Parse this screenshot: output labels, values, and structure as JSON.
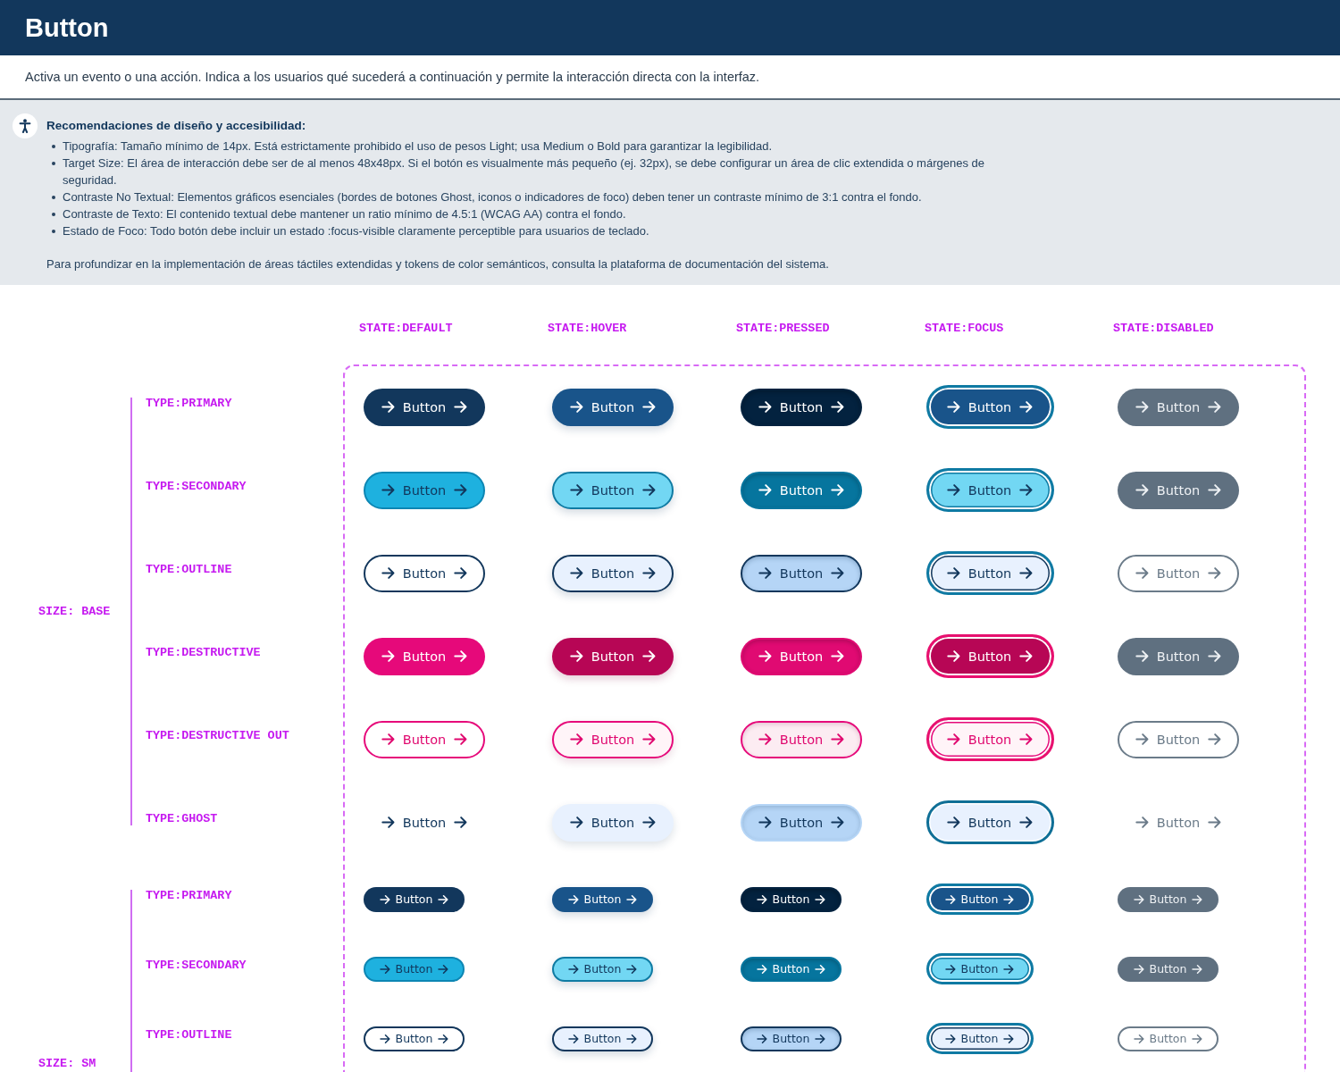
{
  "header": {
    "title": "Button"
  },
  "description": "Activa un evento o una acción. Indica a los usuarios qué sucederá a continuación y permite la interacción directa con la interfaz.",
  "guidelines": {
    "heading": "Recomendaciones de diseño y accesibilidad:",
    "items": [
      "Tipografía: Tamaño mínimo de 14px. Está estrictamente prohibido el uso de pesos Light; usa Medium o Bold para garantizar la legibilidad.",
      "Target Size: El área de interacción debe ser de al menos 48x48px. Si el botón es visualmente más pequeño (ej. 32px), se debe configurar un área de clic extendida o márgenes de seguridad.",
      "Contraste No Textual: Elementos gráficos esenciales (bordes de botones Ghost, iconos o indicadores de foco) deben tener un contraste mínimo de 3:1 contra el fondo.",
      "Contraste de Texto: El contenido textual debe mantener un ratio mínimo de 4.5:1 (WCAG AA) contra el fondo.",
      "Estado de Foco: Todo botón debe incluir un estado :focus-visible claramente perceptible para usuarios de teclado."
    ],
    "footer": "Para profundizar en la implementación de áreas táctiles extendidas y tokens de color semánticos, consulta la plataforma de documentación del sistema."
  },
  "matrix": {
    "states": [
      "STATE:DEFAULT",
      "STATE:HOVER",
      "STATE:PRESSED",
      "STATE:FOCUS",
      "STATE:DISABLED"
    ],
    "sizes": [
      {
        "label": "SIZE: BASE",
        "kind": "base",
        "types": [
          {
            "label": "TYPE:PRIMARY",
            "kind": "primary",
            "buttons": [
              {
                "label": "Button",
                "kind": "default"
              },
              {
                "label": "Button",
                "kind": "hover"
              },
              {
                "label": "Button",
                "kind": "pressed"
              },
              {
                "label": "Button",
                "kind": "focus"
              },
              {
                "label": "Button",
                "kind": "disabled"
              }
            ]
          },
          {
            "label": "TYPE:SECONDARY",
            "kind": "secondary",
            "buttons": [
              {
                "label": "Button",
                "kind": "default"
              },
              {
                "label": "Button",
                "kind": "hover"
              },
              {
                "label": "Button",
                "kind": "pressed"
              },
              {
                "label": "Button",
                "kind": "focus"
              },
              {
                "label": "Button",
                "kind": "disabled"
              }
            ]
          },
          {
            "label": "TYPE:OUTLINE",
            "kind": "outline",
            "buttons": [
              {
                "label": "Button",
                "kind": "default"
              },
              {
                "label": "Button",
                "kind": "hover"
              },
              {
                "label": "Button",
                "kind": "pressed"
              },
              {
                "label": "Button",
                "kind": "focus"
              },
              {
                "label": "Button",
                "kind": "disabled"
              }
            ]
          },
          {
            "label": "TYPE:DESTRUCTIVE",
            "kind": "destructive",
            "buttons": [
              {
                "label": "Button",
                "kind": "default"
              },
              {
                "label": "Button",
                "kind": "hover"
              },
              {
                "label": "Button",
                "kind": "pressed"
              },
              {
                "label": "Button",
                "kind": "focus"
              },
              {
                "label": "Button",
                "kind": "disabled"
              }
            ]
          },
          {
            "label": "TYPE:DESTRUCTIVE OUT",
            "kind": "destructiveout",
            "buttons": [
              {
                "label": "Button",
                "kind": "default"
              },
              {
                "label": "Button",
                "kind": "hover"
              },
              {
                "label": "Button",
                "kind": "pressed"
              },
              {
                "label": "Button",
                "kind": "focus"
              },
              {
                "label": "Button",
                "kind": "disabled"
              }
            ]
          },
          {
            "label": "TYPE:GHOST",
            "kind": "ghost",
            "buttons": [
              {
                "label": "Button",
                "kind": "default"
              },
              {
                "label": "Button",
                "kind": "hover"
              },
              {
                "label": "Button",
                "kind": "pressed"
              },
              {
                "label": "Button",
                "kind": "focus"
              },
              {
                "label": "Button",
                "kind": "disabled"
              }
            ]
          }
        ]
      },
      {
        "label": "SIZE: SM",
        "kind": "sm",
        "types": [
          {
            "label": "TYPE:PRIMARY",
            "kind": "primary",
            "buttons": [
              {
                "label": "Button",
                "kind": "default"
              },
              {
                "label": "Button",
                "kind": "hover"
              },
              {
                "label": "Button",
                "kind": "pressed"
              },
              {
                "label": "Button",
                "kind": "focus"
              },
              {
                "label": "Button",
                "kind": "disabled"
              }
            ]
          },
          {
            "label": "TYPE:SECONDARY",
            "kind": "secondary",
            "buttons": [
              {
                "label": "Button",
                "kind": "default"
              },
              {
                "label": "Button",
                "kind": "hover"
              },
              {
                "label": "Button",
                "kind": "pressed"
              },
              {
                "label": "Button",
                "kind": "focus"
              },
              {
                "label": "Button",
                "kind": "disabled"
              }
            ]
          },
          {
            "label": "TYPE:OUTLINE",
            "kind": "outline",
            "buttons": [
              {
                "label": "Button",
                "kind": "default"
              },
              {
                "label": "Button",
                "kind": "hover"
              },
              {
                "label": "Button",
                "kind": "pressed"
              },
              {
                "label": "Button",
                "kind": "focus"
              },
              {
                "label": "Button",
                "kind": "disabled"
              }
            ]
          }
        ]
      }
    ]
  }
}
